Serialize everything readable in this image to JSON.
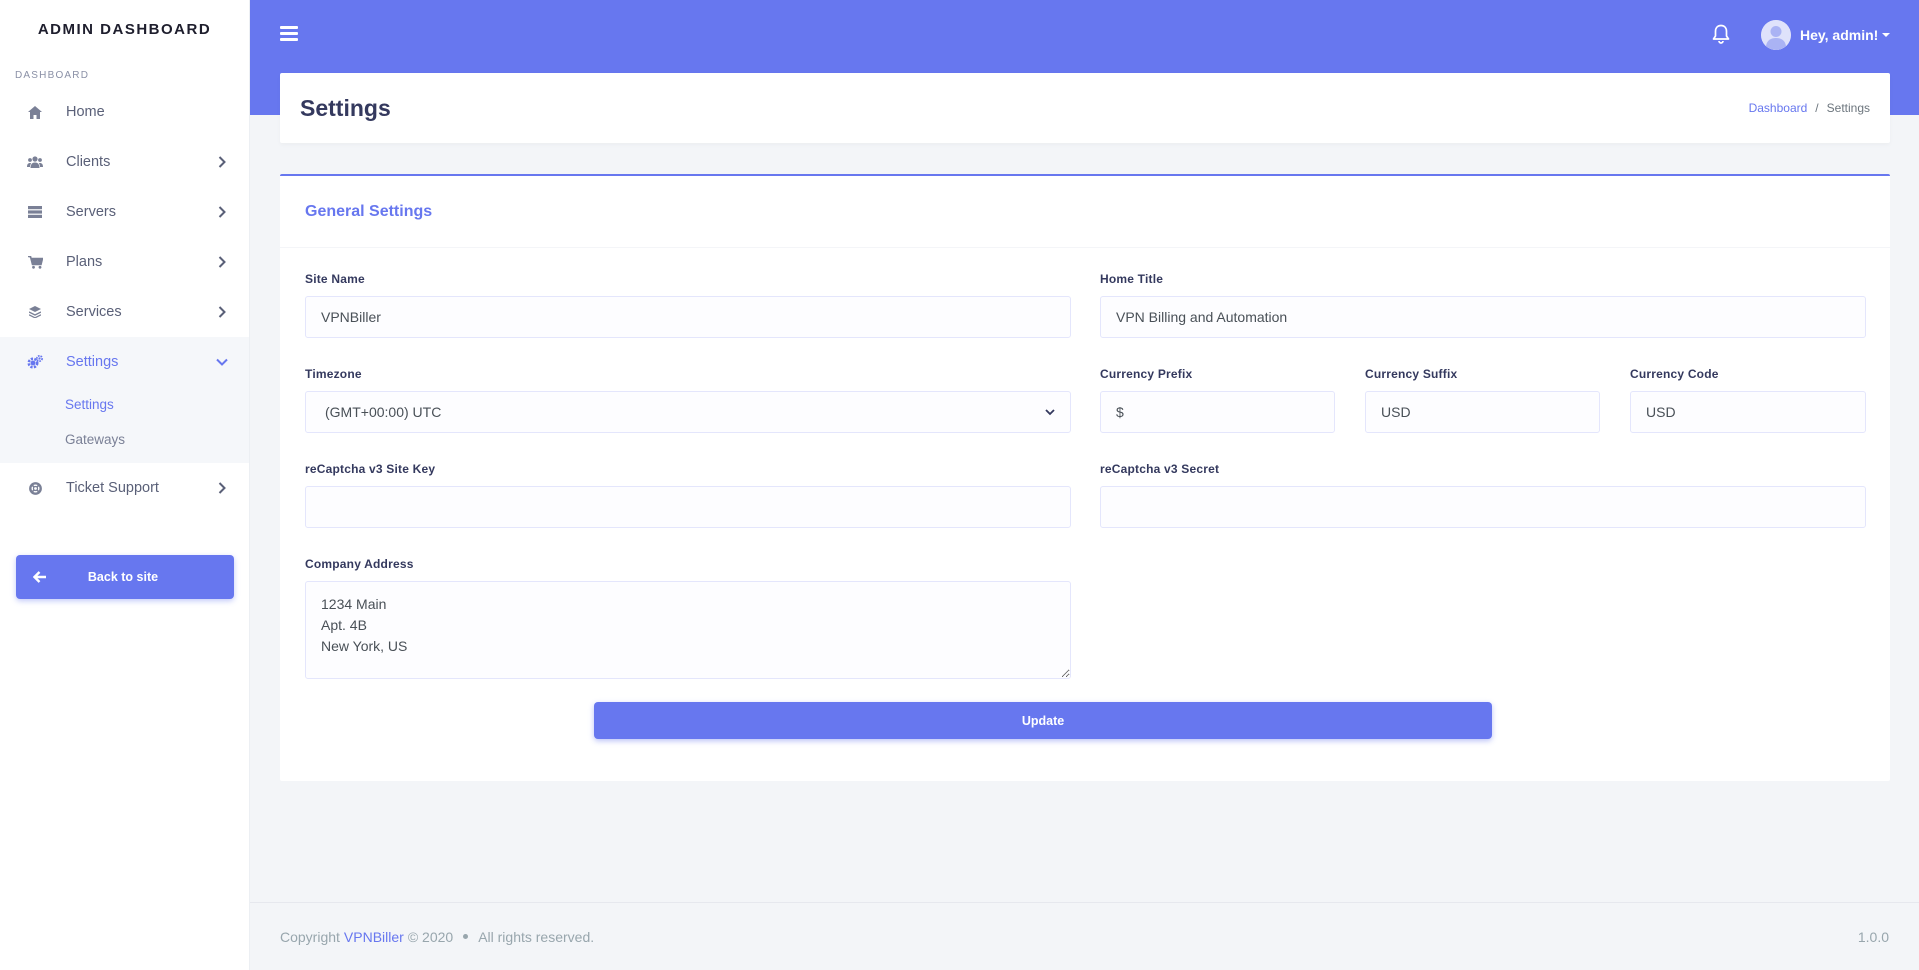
{
  "sidebar": {
    "brand": "ADMIN DASHBOARD",
    "heading": "DASHBOARD",
    "items": [
      {
        "label": "Home",
        "icon": "home-icon"
      },
      {
        "label": "Clients",
        "icon": "users-icon"
      },
      {
        "label": "Servers",
        "icon": "server-icon"
      },
      {
        "label": "Plans",
        "icon": "cart-icon"
      },
      {
        "label": "Services",
        "icon": "layers-icon"
      },
      {
        "label": "Settings",
        "icon": "cogs-icon"
      },
      {
        "label": "Ticket Support",
        "icon": "support-icon"
      }
    ],
    "settings_submenu": [
      {
        "label": "Settings"
      },
      {
        "label": "Gateways"
      }
    ],
    "back_button": "Back to site"
  },
  "topbar": {
    "user_greeting": "Hey, admin!"
  },
  "page": {
    "title": "Settings",
    "breadcrumb": [
      "Dashboard",
      "Settings"
    ]
  },
  "card": {
    "title": "General Settings"
  },
  "form": {
    "site_name": {
      "label": "Site Name",
      "value": "VPNBiller"
    },
    "home_title": {
      "label": "Home Title",
      "value": "VPN Billing and Automation"
    },
    "timezone": {
      "label": "Timezone",
      "value": "(GMT+00:00) UTC"
    },
    "currency_prefix": {
      "label": "Currency Prefix",
      "value": "$"
    },
    "currency_suffix": {
      "label": "Currency Suffix",
      "value": "USD"
    },
    "currency_code": {
      "label": "Currency Code",
      "value": "USD"
    },
    "recaptcha_site_key": {
      "label": "reCaptcha v3 Site Key",
      "value": ""
    },
    "recaptcha_secret": {
      "label": "reCaptcha v3 Secret",
      "value": ""
    },
    "company_address": {
      "label": "Company Address",
      "value": "1234 Main\nApt. 4B\nNew York, US"
    },
    "update_button": "Update"
  },
  "footer": {
    "copyright_prefix": "Copyright",
    "brand_link": "VPNBiller",
    "year": "© 2020",
    "rights": "All rights reserved.",
    "version": "1.0.0"
  },
  "colors": {
    "accent": "#6777ef",
    "background": "#f3f5f8"
  }
}
